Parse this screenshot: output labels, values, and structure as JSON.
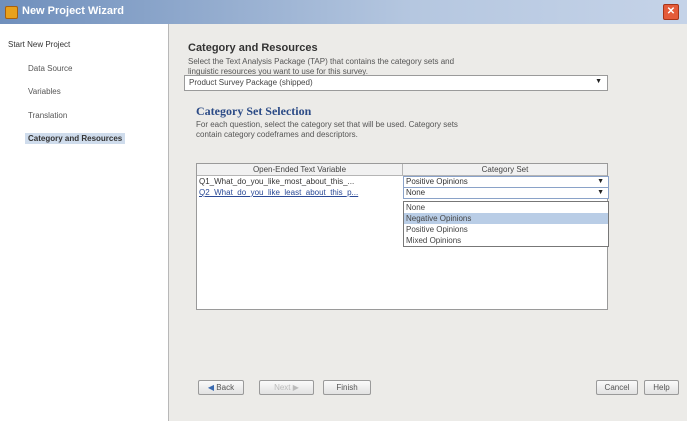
{
  "window": {
    "title": "New Project Wizard"
  },
  "sidebar": {
    "root": "Start New Project",
    "steps": [
      "Data Source",
      "Variables",
      "Translation",
      "Category and Resources"
    ]
  },
  "main": {
    "heading": "Category and Resources",
    "description_line1": "Select the Text Analysis Package (TAP) that contains the category sets and",
    "description_line2": "linguistic resources you want to use for this survey.",
    "package": {
      "value": "Product Survey Package (shipped)"
    },
    "section_title": "Category Set Selection",
    "section_desc_line1": "For each question, select the category set that will be used. Category sets",
    "section_desc_line2": "contain category codeframes and descriptors.",
    "table": {
      "headers": [
        "Open-Ended Text Variable",
        "Category Set"
      ],
      "rows": [
        {
          "variable": "Q1_What_do_you_like_most_about_this_...",
          "category": "Positive Opinions"
        },
        {
          "variable": "Q2_What_do_you_like_least_about_this_p...",
          "category": "None"
        }
      ],
      "dropdown_options": [
        "None",
        "Negative Opinions",
        "Positive Opinions",
        "Mixed Opinions"
      ],
      "highlighted_option": "Negative Opinions"
    }
  },
  "buttons": {
    "back": "Back",
    "next": "Next",
    "finish": "Finish",
    "cancel": "Cancel",
    "help": "Help"
  },
  "icons": [
    "app-icon",
    "close-icon",
    "dropdown-arrow-icon",
    "back-arrow-icon",
    "next-arrow-icon"
  ],
  "colors": {
    "titlebar": "#6f8fbc",
    "section_title": "#2c4b86",
    "selection": "#b9cde6"
  }
}
